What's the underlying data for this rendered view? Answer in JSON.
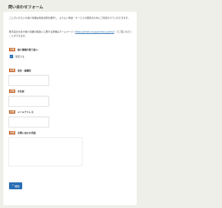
{
  "header": {
    "title": "問い合わせフォーム"
  },
  "intro": {
    "text1": "ご入力いただいた個人情報は利用目的を厳守し、よりよい商品・サービスの提供のためにご利用させていただきます。",
    "text2_prefix": "株式会社大倉の個人情報の取扱いに関する詳細はホームページ（",
    "text2_link": "https://amijiu.co.jp/privacy-policy/",
    "text2_suffix": "）でご覧いただくことができます。"
  },
  "required_badge": "必須",
  "fields": {
    "privacy": {
      "label": "個人情報の取り扱い",
      "checkbox_label": "同意する",
      "checked": true
    },
    "company": {
      "label": "会社・組織名",
      "value": ""
    },
    "name": {
      "label": "お名前",
      "value": ""
    },
    "email": {
      "label": "メールアドレス",
      "value": ""
    },
    "inquiry": {
      "label": "お問い合わせ内容",
      "value": ""
    }
  },
  "submit": {
    "label": "確認",
    "icon": "arrow-right-icon"
  },
  "colors": {
    "accent": "#2a6fb5",
    "required": "#c2662a",
    "background": "#efefe9"
  }
}
